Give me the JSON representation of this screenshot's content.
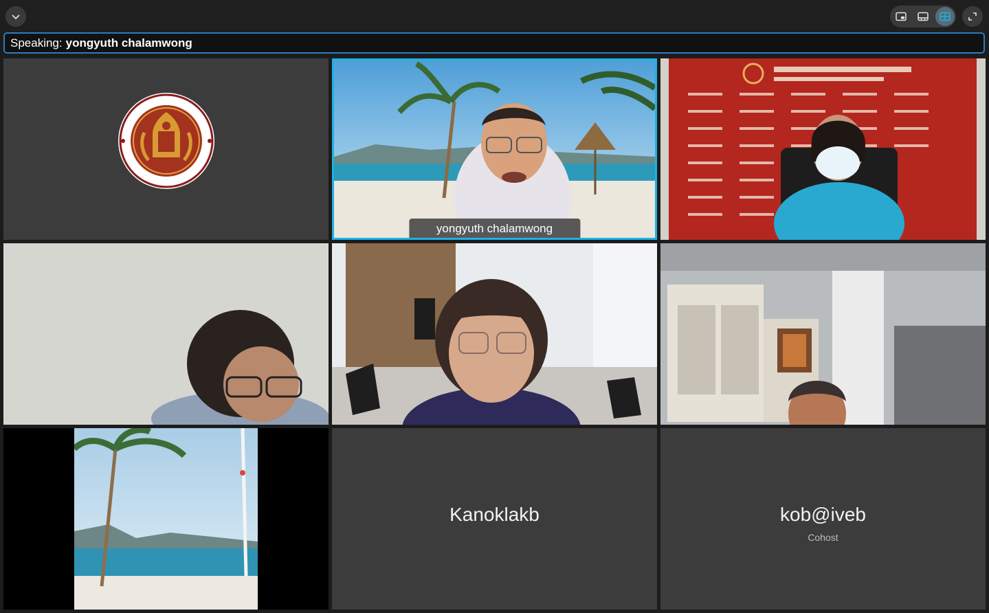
{
  "window": {
    "collapse_icon": "chevron-down-icon",
    "view_icons": [
      "picture-in-picture-icon",
      "speaker-view-icon",
      "gallery-view-icon"
    ],
    "fullscreen_icon": "expand-icon",
    "accent_color": "#1fb3e4"
  },
  "speaking": {
    "label": "Speaking:",
    "name": "yongyuth chalamwong"
  },
  "tiles": [
    {
      "type": "logo"
    },
    {
      "type": "video",
      "name_tag": "yongyuth chalamwong",
      "active": true
    },
    {
      "type": "video"
    },
    {
      "type": "video"
    },
    {
      "type": "video"
    },
    {
      "type": "video"
    },
    {
      "type": "video"
    },
    {
      "type": "placeholder",
      "display_name": "Kanoklakb"
    },
    {
      "type": "placeholder",
      "display_name": "kob@iveb",
      "role": "Cohost"
    }
  ]
}
